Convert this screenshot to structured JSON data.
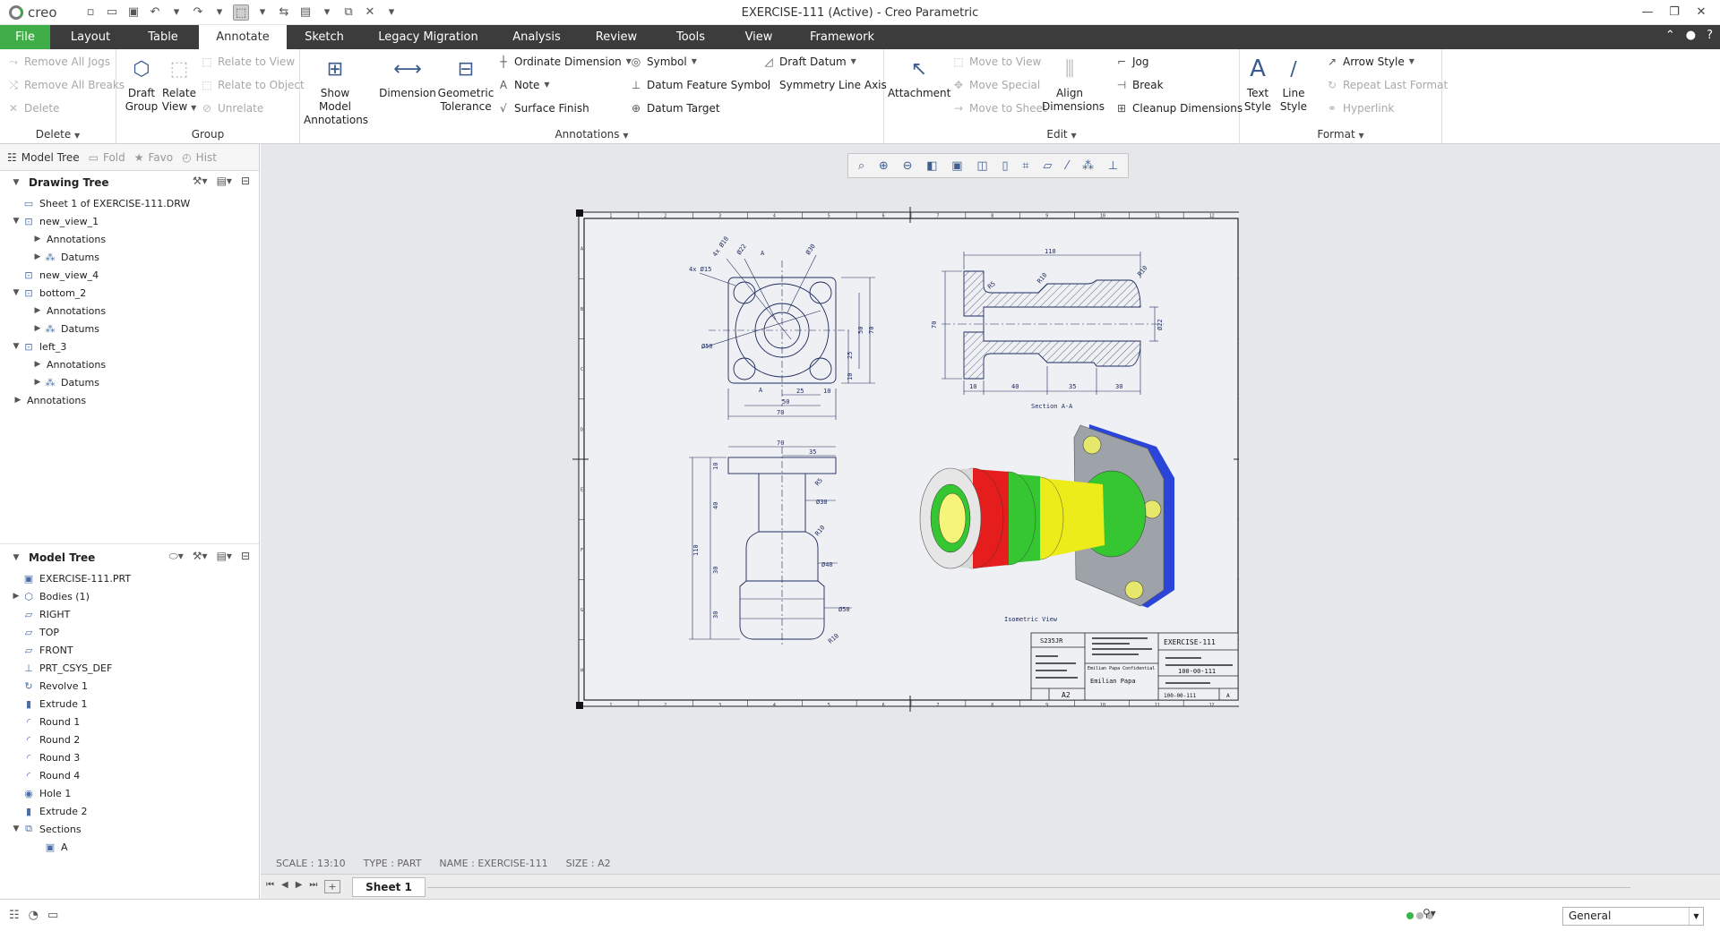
{
  "app": {
    "logo": "creo",
    "window_title": "EXERCISE-111 (Active) - Creo Parametric"
  },
  "menu": {
    "tabs": [
      "File",
      "Layout",
      "Table",
      "Annotate",
      "Sketch",
      "Legacy Migration",
      "Analysis",
      "Review",
      "Tools",
      "View",
      "Framework"
    ],
    "active": "Annotate"
  },
  "ribbon": {
    "delete": {
      "remove_all_jogs": "Remove All Jogs",
      "remove_all_breaks": "Remove All Breaks",
      "delete": "Delete",
      "label": "Delete"
    },
    "group": {
      "draft_group": [
        "Draft",
        "Group"
      ],
      "relate_view": [
        "Relate",
        "View"
      ],
      "relate_to_view": "Relate to View",
      "relate_to_object": "Relate to Object",
      "unrelate": "Unrelate",
      "label": "Group"
    },
    "annotations": {
      "show_model_annotations": [
        "Show Model",
        "Annotations"
      ],
      "dimension": "Dimension",
      "geometric_tolerance": [
        "Geometric",
        "Tolerance"
      ],
      "ordinate_dimension": "Ordinate Dimension",
      "note": "Note",
      "surface_finish": "Surface Finish",
      "symbol": "Symbol",
      "datum_feature_symbol": "Datum Feature Symbol",
      "datum_target": "Datum Target",
      "draft_datum": "Draft Datum",
      "symmetry_line_axis": "Symmetry Line Axis",
      "label": "Annotations"
    },
    "edit": {
      "attachment": "Attachment",
      "move_to_view": "Move to View",
      "move_special": "Move Special",
      "move_to_sheet": "Move to Sheet",
      "align_dimensions": [
        "Align",
        "Dimensions"
      ],
      "jog": "Jog",
      "break": "Break",
      "cleanup_dimensions": "Cleanup Dimensions",
      "label": "Edit"
    },
    "format": {
      "text_style": [
        "Text",
        "Style"
      ],
      "line_style": [
        "Line",
        "Style"
      ],
      "arrow_style": "Arrow Style",
      "repeat_last_format": "Repeat Last Format",
      "hyperlink": "Hyperlink",
      "label": "Format"
    }
  },
  "left_panel": {
    "tabs": [
      "Model Tree",
      "Fold",
      "Favo",
      "Hist"
    ],
    "drawing_tree": {
      "title": "Drawing Tree",
      "items": [
        {
          "label": "Sheet 1 of EXERCISE-111.DRW",
          "level": 0,
          "twisty": "",
          "icon": "sheet-icon"
        },
        {
          "label": "new_view_1",
          "level": 0,
          "twisty": "open",
          "icon": "view-icon"
        },
        {
          "label": "Annotations",
          "level": 1,
          "twisty": "closed",
          "icon": ""
        },
        {
          "label": "Datums",
          "level": 1,
          "twisty": "closed",
          "icon": "datum-icon"
        },
        {
          "label": "new_view_4",
          "level": 0,
          "twisty": "",
          "icon": "view-icon"
        },
        {
          "label": "bottom_2",
          "level": 0,
          "twisty": "open",
          "icon": "view-icon"
        },
        {
          "label": "Annotations",
          "level": 1,
          "twisty": "closed",
          "icon": ""
        },
        {
          "label": "Datums",
          "level": 1,
          "twisty": "closed",
          "icon": "datum-icon"
        },
        {
          "label": "left_3",
          "level": 0,
          "twisty": "open",
          "icon": "view-icon"
        },
        {
          "label": "Annotations",
          "level": 1,
          "twisty": "closed",
          "icon": ""
        },
        {
          "label": "Datums",
          "level": 1,
          "twisty": "closed",
          "icon": "datum-icon"
        },
        {
          "label": "Annotations",
          "level": -1,
          "twisty": "closed",
          "icon": ""
        }
      ]
    },
    "model_tree": {
      "title": "Model Tree",
      "items": [
        {
          "label": "EXERCISE-111.PRT",
          "level": 0,
          "twisty": "",
          "icon": "part-icon"
        },
        {
          "label": "Bodies (1)",
          "level": 0,
          "twisty": "closed",
          "icon": "bodies-icon"
        },
        {
          "label": "RIGHT",
          "level": 0,
          "twisty": "",
          "icon": "plane-icon"
        },
        {
          "label": "TOP",
          "level": 0,
          "twisty": "",
          "icon": "plane-icon"
        },
        {
          "label": "FRONT",
          "level": 0,
          "twisty": "",
          "icon": "plane-icon"
        },
        {
          "label": "PRT_CSYS_DEF",
          "level": 0,
          "twisty": "",
          "icon": "csys-icon"
        },
        {
          "label": "Revolve 1",
          "level": 0,
          "twisty": "",
          "icon": "revolve-icon"
        },
        {
          "label": "Extrude 1",
          "level": 0,
          "twisty": "",
          "icon": "extrude-icon"
        },
        {
          "label": "Round 1",
          "level": 0,
          "twisty": "",
          "icon": "round-icon"
        },
        {
          "label": "Round 2",
          "level": 0,
          "twisty": "",
          "icon": "round-icon"
        },
        {
          "label": "Round 3",
          "level": 0,
          "twisty": "",
          "icon": "round-icon"
        },
        {
          "label": "Round 4",
          "level": 0,
          "twisty": "",
          "icon": "round-icon"
        },
        {
          "label": "Hole 1",
          "level": 0,
          "twisty": "",
          "icon": "hole-icon"
        },
        {
          "label": "Extrude 2",
          "level": 0,
          "twisty": "",
          "icon": "extrude-icon"
        },
        {
          "label": "Sections",
          "level": 0,
          "twisty": "open",
          "icon": "sections-icon"
        },
        {
          "label": "A",
          "level": 1,
          "twisty": "",
          "icon": "section-icon"
        }
      ]
    }
  },
  "drawing": {
    "front_dims": [
      "4x Ø10",
      "Ø22",
      "A",
      "Ø30",
      "4x Ø15",
      "Ø50",
      "70",
      "50",
      "25",
      "10",
      "A",
      "25",
      "50",
      "10",
      "70"
    ],
    "section_dims": [
      "110",
      "R5",
      "R10",
      "R10",
      "70",
      "Ø22",
      "10",
      "40",
      "35",
      "30"
    ],
    "section_label": "Section A-A",
    "bottom_dims": [
      "70",
      "35",
      "10",
      "R5",
      "Ø30",
      "R10",
      "Ø40",
      "Ø50",
      "R10",
      "40",
      "30",
      "110",
      "30"
    ],
    "iso_label": "Isometric View",
    "border_nums": [
      "1",
      "2",
      "3",
      "4",
      "5",
      "6",
      "7",
      "8",
      "9",
      "10",
      "11",
      "12"
    ],
    "border_letters": [
      "A",
      "B",
      "C",
      "D",
      "E",
      "F",
      "G",
      "H"
    ],
    "title_block": {
      "material": "S235JR",
      "title": "EXERCISE-111",
      "company": "Emilian Papa",
      "confidential": "Emilian Papa Confidential",
      "size": "A2",
      "drawing_no": "100-00-111",
      "drawing_no2": "100-00-111",
      "sheet": "A"
    }
  },
  "status": {
    "scale": "SCALE : 13:10",
    "type": "TYPE : PART",
    "name": "NAME : EXERCISE-111",
    "size": "SIZE : A2"
  },
  "sheet_tab": "Sheet 1",
  "filter": {
    "value": "General"
  }
}
